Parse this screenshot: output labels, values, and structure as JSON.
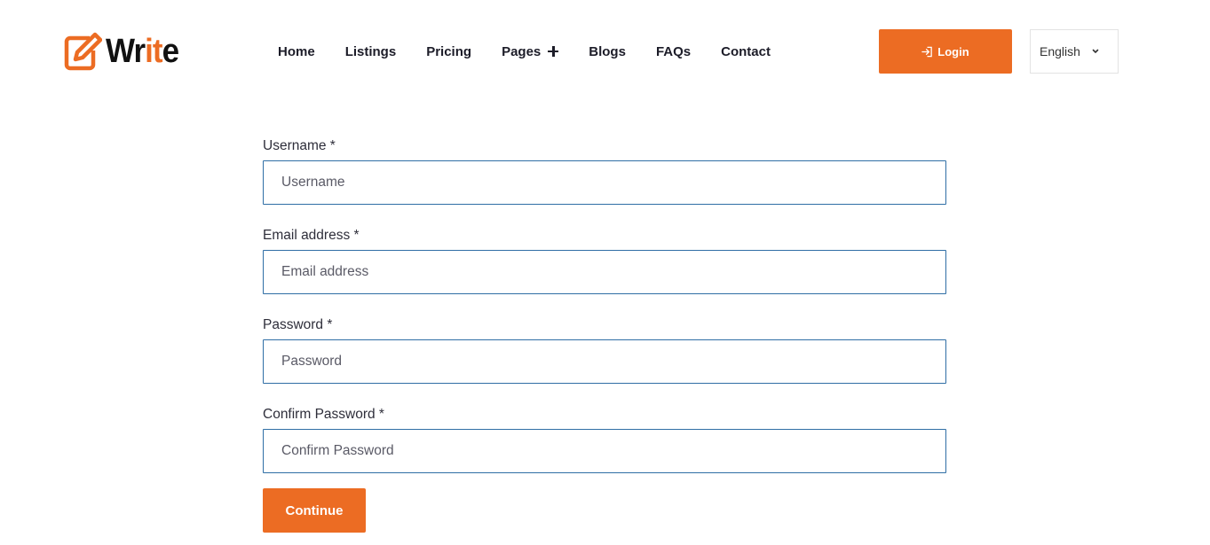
{
  "brand": {
    "logo_text_part1": "Wr",
    "logo_text_part2": "it",
    "logo_text_part3": "e",
    "icon": "pencil-square-icon",
    "accent_color": "#ec6c23"
  },
  "nav": {
    "items": [
      {
        "label": "Home"
      },
      {
        "label": "Listings"
      },
      {
        "label": "Pricing"
      },
      {
        "label": "Pages",
        "icon": "plus-icon"
      },
      {
        "label": "Blogs"
      },
      {
        "label": "FAQs"
      },
      {
        "label": "Contact"
      }
    ]
  },
  "header": {
    "login_label": "Login",
    "login_icon": "login-arrow-icon",
    "language": "English",
    "language_icon": "chevron-down-icon"
  },
  "form": {
    "fields": [
      {
        "label": "Username *",
        "placeholder": "Username",
        "value": ""
      },
      {
        "label": "Email address *",
        "placeholder": "Email address",
        "value": ""
      },
      {
        "label": "Password *",
        "placeholder": "Password",
        "value": ""
      },
      {
        "label": "Confirm Password *",
        "placeholder": "Confirm Password",
        "value": ""
      }
    ],
    "submit_label": "Continue"
  }
}
